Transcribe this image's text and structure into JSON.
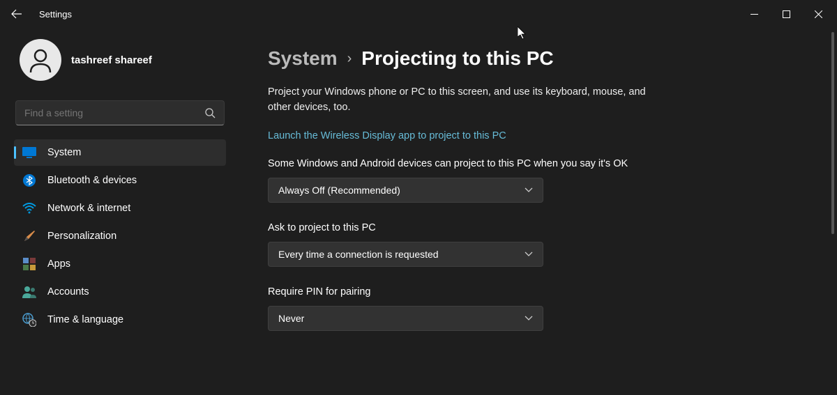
{
  "window": {
    "title": "Settings"
  },
  "profile": {
    "name": "tashreef shareef"
  },
  "search": {
    "placeholder": "Find a setting"
  },
  "nav": {
    "items": [
      {
        "label": "System"
      },
      {
        "label": "Bluetooth & devices"
      },
      {
        "label": "Network & internet"
      },
      {
        "label": "Personalization"
      },
      {
        "label": "Apps"
      },
      {
        "label": "Accounts"
      },
      {
        "label": "Time & language"
      }
    ]
  },
  "breadcrumb": {
    "root": "System",
    "current": "Projecting to this PC"
  },
  "page": {
    "description": "Project your Windows phone or PC to this screen, and use its keyboard, mouse, and other devices, too.",
    "link": "Launch the Wireless Display app to project to this PC",
    "settings": [
      {
        "label": "Some Windows and Android devices can project to this PC when you say it's OK",
        "value": "Always Off (Recommended)"
      },
      {
        "label": "Ask to project to this PC",
        "value": "Every time a connection is requested"
      },
      {
        "label": "Require PIN for pairing",
        "value": "Never"
      }
    ]
  }
}
